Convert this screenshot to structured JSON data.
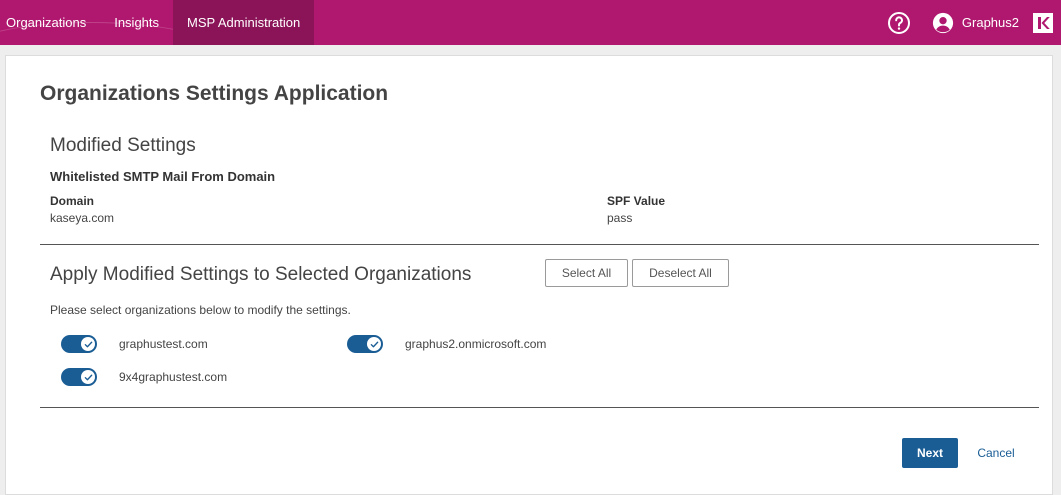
{
  "nav": {
    "tabs": [
      {
        "label": "Organizations"
      },
      {
        "label": "Insights"
      },
      {
        "label": "MSP Administration"
      }
    ],
    "username": "Graphus2"
  },
  "page": {
    "title": "Organizations Settings Application"
  },
  "modified": {
    "heading": "Modified Settings",
    "setting_name": "Whitelisted SMTP Mail From Domain",
    "domain_label": "Domain",
    "domain_value": "kaseya.com",
    "spf_label": "SPF Value",
    "spf_value": "pass"
  },
  "apply": {
    "heading": "Apply Modified Settings to Selected Organizations",
    "select_all": "Select All",
    "deselect_all": "Deselect All",
    "hint": "Please select organizations below to modify the settings.",
    "organizations": [
      {
        "name": "graphustest.com",
        "enabled": true
      },
      {
        "name": "graphus2.onmicrosoft.com",
        "enabled": true
      },
      {
        "name": "9x4graphustest.com",
        "enabled": true
      }
    ]
  },
  "actions": {
    "next": "Next",
    "cancel": "Cancel"
  },
  "colors": {
    "brand": "#b0186f",
    "active_tab": "#8b1458",
    "primary": "#1a5d95"
  }
}
